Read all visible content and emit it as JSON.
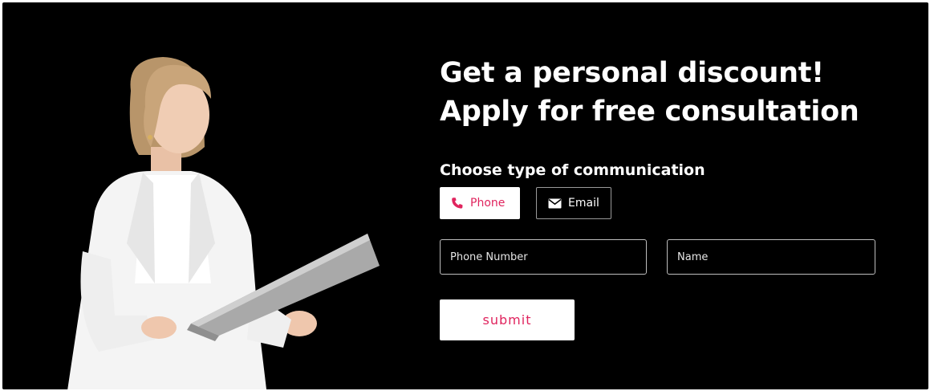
{
  "promo": {
    "headline_line1": "Get a personal discount!",
    "headline_line2": "Apply for free consultation",
    "communication_title": "Choose type of communication",
    "options": {
      "phone": {
        "label": "Phone",
        "icon": "phone-icon",
        "selected": true
      },
      "email": {
        "label": "Email",
        "icon": "envelope-icon",
        "selected": false
      }
    }
  },
  "form": {
    "phone_placeholder": "Phone Number",
    "name_placeholder": "Name",
    "submit_label": "submit"
  },
  "colors": {
    "background": "#000000",
    "accent": "#e0245e",
    "text": "#ffffff"
  }
}
